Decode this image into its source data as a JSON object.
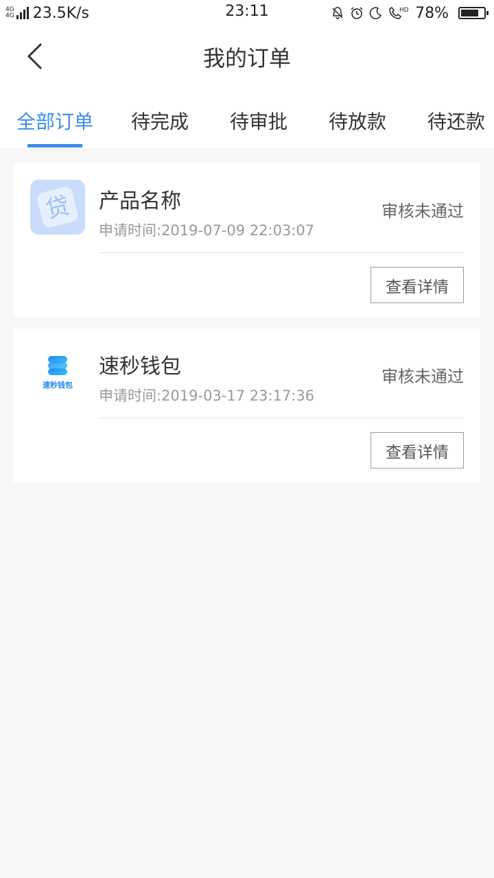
{
  "status_bar": {
    "net_top": "4G",
    "net_bottom": "4G",
    "speed": "23.5K/s",
    "time": "23:11",
    "battery": "78%",
    "battery_level": 0.78,
    "icons": [
      "bell-off-icon",
      "alarm-icon",
      "moon-icon",
      "hd-call-icon"
    ]
  },
  "header": {
    "title": "我的订单",
    "back_icon": "chevron-left-icon"
  },
  "tabs": [
    {
      "label": "全部订单",
      "active": true
    },
    {
      "label": "待完成",
      "active": false
    },
    {
      "label": "待审批",
      "active": false
    },
    {
      "label": "待放款",
      "active": false
    },
    {
      "label": "待还款",
      "active": false
    }
  ],
  "orders": [
    {
      "name": "产品名称",
      "apply_time": "申请时间:2019-07-09 22:03:07",
      "status": "审核未通过",
      "button": "查看详情",
      "logo_text": "贷"
    },
    {
      "name": "速秒钱包",
      "apply_time": "申请时间:2019-03-17 23:17:36",
      "status": "审核未通过",
      "button": "查看详情",
      "logo_text": "速秒钱包"
    }
  ],
  "colors": {
    "accent": "#3b8cf0",
    "background": "#f7f7f7"
  }
}
